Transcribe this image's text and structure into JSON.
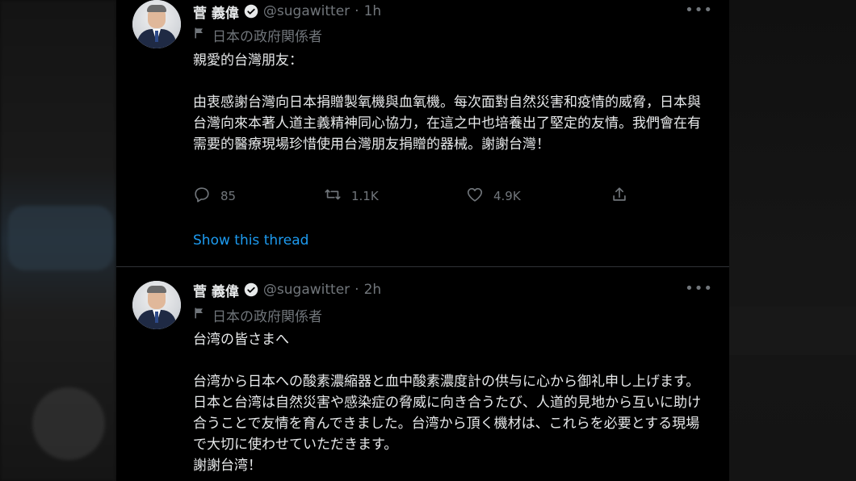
{
  "tweets": [
    {
      "author_name": "菅 義偉",
      "handle": "@sugawitter",
      "separator": "·",
      "time": "1h",
      "more": "•••",
      "affiliation": "日本の政府関係者",
      "text": "親愛的台灣朋友：\n\n由衷感謝台灣向日本捐贈製氧機與血氧機。每次面對自然災害和疫情的威脅，日本與台灣向來本著人道主義精神同心協力，在這之中也培養出了堅定的友情。我們會在有需要的醫療現場珍惜使用台灣朋友捐贈的器械。謝謝台灣！",
      "replies": "85",
      "retweets": "1.1K",
      "likes": "4.9K",
      "show_thread": "Show this thread"
    },
    {
      "author_name": "菅 義偉",
      "handle": "@sugawitter",
      "separator": "·",
      "time": "2h",
      "more": "•••",
      "affiliation": "日本の政府関係者",
      "text": "台湾の皆さまへ\n\n台湾から日本への酸素濃縮器と血中酸素濃度計の供与に心から御礼申し上げます。日本と台湾は自然災害や感染症の脅威に向き合うたび、人道的見地から互いに助け合うことで友情を育んできました。台湾から頂く機材は、これらを必要とする現場で大切に使わせていただきます。\n謝謝台湾！"
    }
  ],
  "colors": {
    "background": "#000000",
    "text": "#e7e9ea",
    "secondary": "#71767b",
    "link": "#1d9bf0"
  },
  "icons": [
    "verified-badge-icon",
    "flag-icon",
    "reply-icon",
    "retweet-icon",
    "like-icon",
    "share-icon",
    "more-icon"
  ]
}
